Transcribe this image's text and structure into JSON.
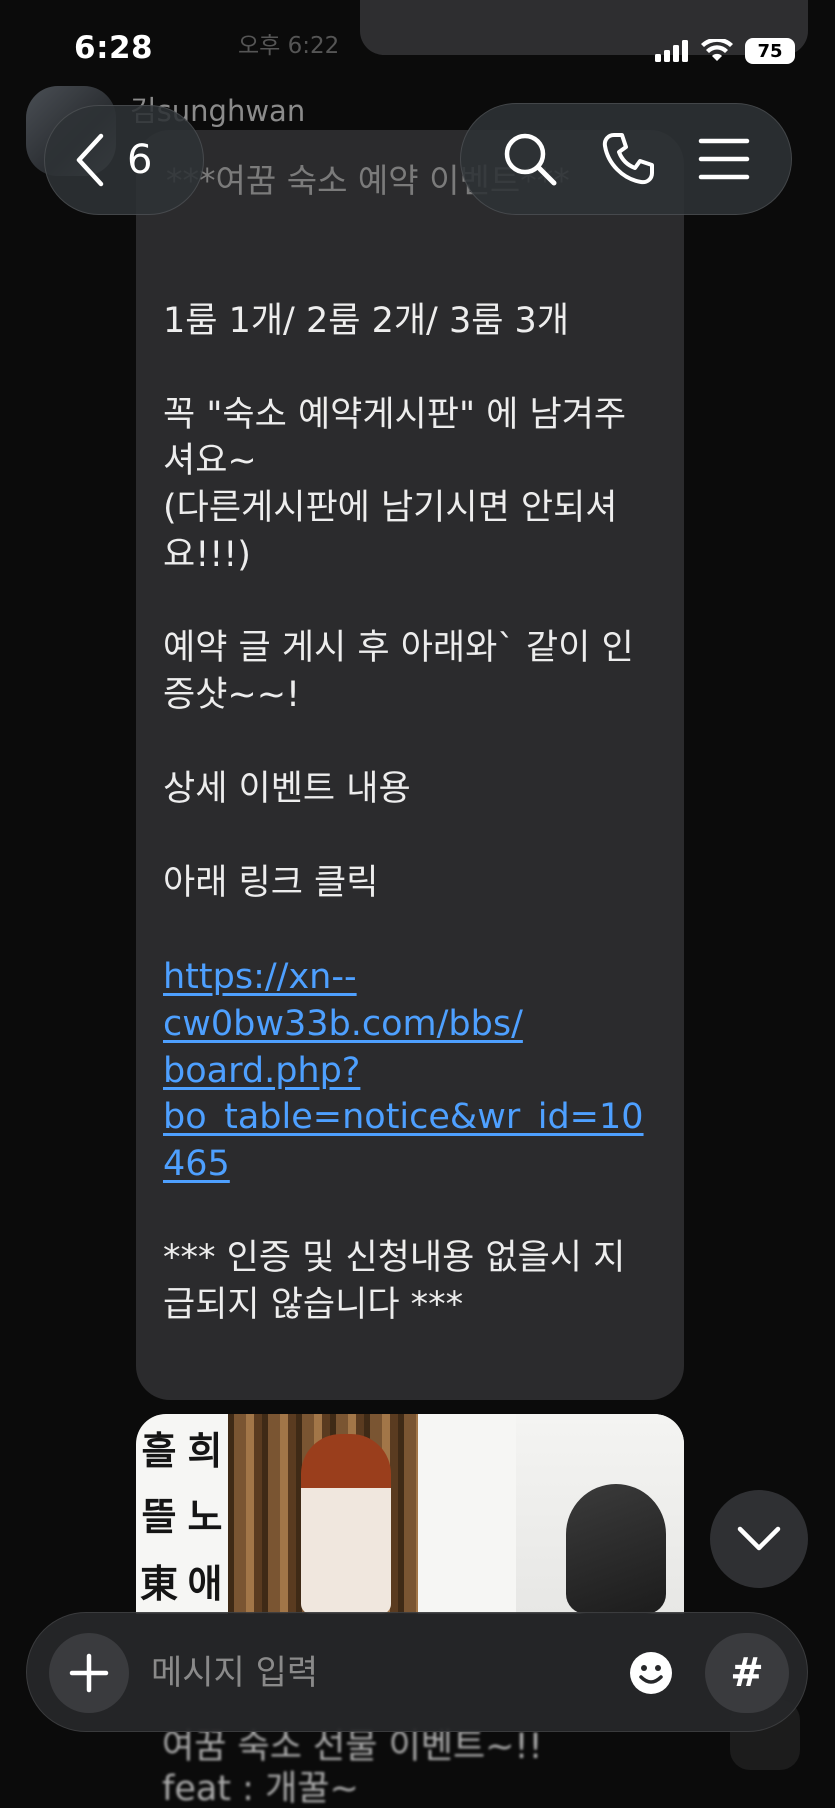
{
  "status_bar": {
    "time": "6:28",
    "battery": "75"
  },
  "chat": {
    "timestamp": "오후 6:22",
    "sender": "김sunghwan",
    "back_count": "6"
  },
  "message": {
    "title": "***여꿈 숙소 예약 이벤트***",
    "lines": [
      "1룸 1개/ 2룸 2개/ 3룸 3개",
      "꼭  \"숙소 예약게시판\" 에 남겨주",
      "셔요~",
      "(다른게시판에 남기시면 안되셔",
      "요!!!)",
      "예약 글 게시 후 아래와` 같이 인",
      "증샷~~!",
      "상세 이벤트 내용",
      "아래 링크 클릭"
    ],
    "link_lines": [
      "https://xn--",
      "cw0bw33b.com/bbs/",
      "board.php?",
      "bo_table=notice&wr_id=10",
      "465"
    ],
    "footer_lines": [
      "*** 인증 및 신청내용 없을시 지",
      "급되지 않습니다 ***"
    ]
  },
  "image": {
    "calligraphy_left": [
      "흘",
      "뜰",
      "東"
    ],
    "calligraphy_right": [
      "희",
      "노",
      "애"
    ]
  },
  "next_message": {
    "lines": [
      "여꿈 숙소 선물 이벤트~!!",
      "feat : 개꿀~"
    ]
  },
  "input": {
    "placeholder": "메시지 입력",
    "hash_label": "#"
  },
  "icons": {
    "back": "chevron-left-icon",
    "search": "search-icon",
    "call": "phone-icon",
    "menu": "menu-icon",
    "plus": "plus-icon",
    "emoji": "emoji-icon",
    "scroll_down": "chevron-down-icon"
  }
}
